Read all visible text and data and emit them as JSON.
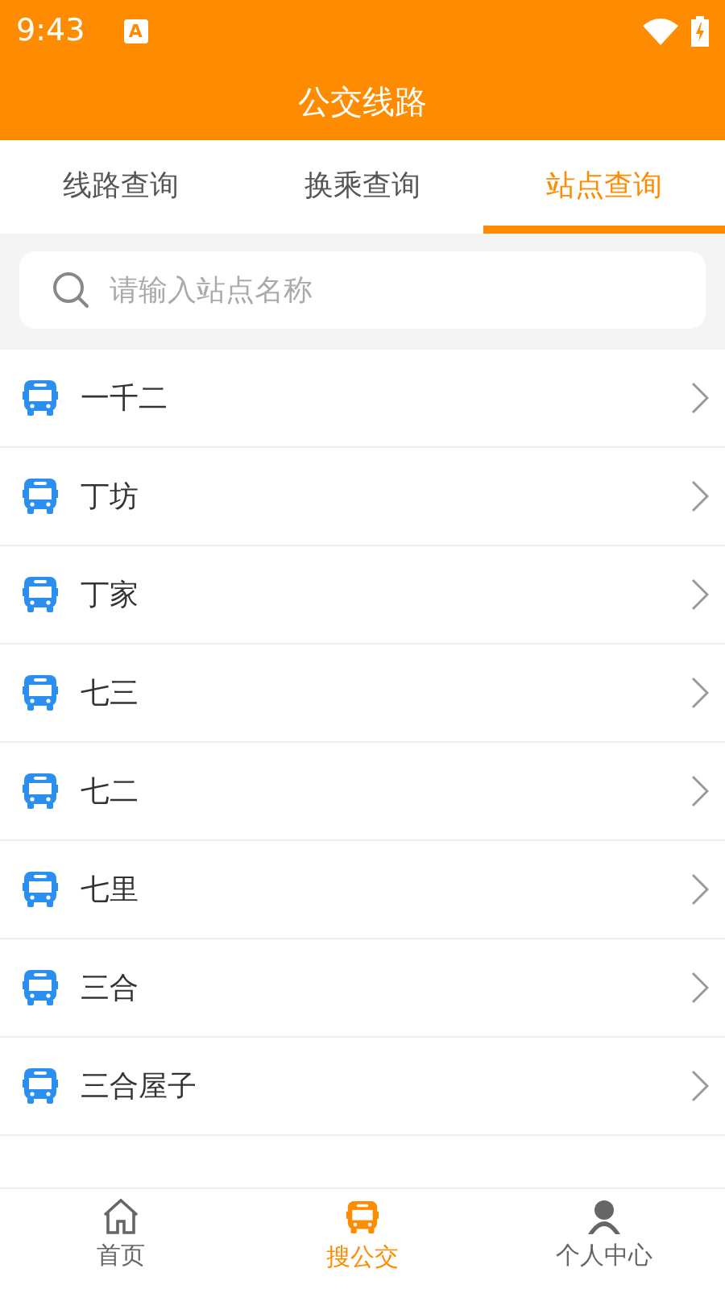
{
  "status_bar": {
    "time": "9:43",
    "notification": "A"
  },
  "title": "公交线路",
  "tabs": [
    {
      "label": "线路查询",
      "selected": false
    },
    {
      "label": "换乘查询",
      "selected": false
    },
    {
      "label": "站点查询",
      "selected": true
    }
  ],
  "search": {
    "placeholder": "请输入站点名称"
  },
  "stations": [
    {
      "name": "一千二"
    },
    {
      "name": "丁坊"
    },
    {
      "name": "丁家"
    },
    {
      "name": "七三"
    },
    {
      "name": "七二"
    },
    {
      "name": "七里"
    },
    {
      "name": "三合"
    },
    {
      "name": "三合屋子"
    }
  ],
  "bottom_nav": [
    {
      "kind": "home",
      "label": "首页",
      "selected": false
    },
    {
      "kind": "bus",
      "label": "搜公交",
      "selected": true
    },
    {
      "kind": "person",
      "label": "个人中心",
      "selected": false
    }
  ]
}
